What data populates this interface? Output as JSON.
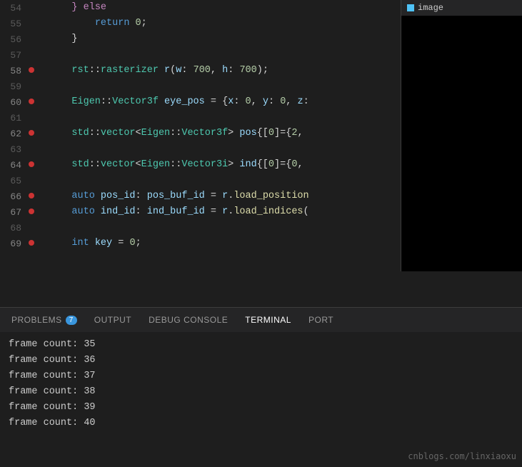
{
  "editor": {
    "lines": [
      {
        "num": "54",
        "content_html": "&nbsp;&nbsp;&nbsp;&nbsp;<span class='kw2'>}</span> <span class='kw2'>else</span>",
        "breakpoint": false,
        "fold": false
      },
      {
        "num": "55",
        "content_html": "&nbsp;&nbsp;&nbsp;&nbsp;&nbsp;&nbsp;&nbsp;&nbsp;<span class='kw'>return</span> <span class='num'>0</span><span class='punc'>;</span>",
        "breakpoint": false,
        "fold": false
      },
      {
        "num": "56",
        "content_html": "&nbsp;&nbsp;&nbsp;&nbsp;<span class='punc'>}</span>",
        "breakpoint": false,
        "fold": false
      },
      {
        "num": "57",
        "content_html": "",
        "breakpoint": false,
        "fold": false
      },
      {
        "num": "58",
        "content_html": "&nbsp;&nbsp;&nbsp;&nbsp;<span class='type'>rst</span><span class='punc'>::</span><span class='type'>rasterizer</span> <span class='var'>r</span><span class='punc'>(</span><span class='param'>w</span><span class='punc'>:</span> <span class='num'>700</span><span class='punc'>,</span> <span class='param'>h</span><span class='punc'>:</span> <span class='num'>700</span><span class='punc'>);</span>",
        "breakpoint": true,
        "fold": false
      },
      {
        "num": "59",
        "content_html": "",
        "breakpoint": false,
        "fold": false
      },
      {
        "num": "60",
        "content_html": "&nbsp;&nbsp;&nbsp;&nbsp;<span class='type'>Eigen</span><span class='punc'>::</span><span class='type'>Vector3f</span> <span class='var'>eye_pos</span> <span class='op'>=</span> <span class='punc'>{</span><span class='param'>x</span><span class='punc'>:</span> <span class='num'>0</span><span class='punc'>,</span> <span class='param'>y</span><span class='punc'>:</span> <span class='num'>0</span><span class='punc'>,</span> <span class='param'>z</span><span class='punc'>:</span>",
        "breakpoint": true,
        "fold": false
      },
      {
        "num": "61",
        "content_html": "",
        "breakpoint": false,
        "fold": false
      },
      {
        "num": "62",
        "content_html": "&nbsp;&nbsp;&nbsp;&nbsp;<span class='type'>std</span><span class='punc'>::</span><span class='type'>vector</span><span class='punc'>&lt;</span><span class='type'>Eigen</span><span class='punc'>::</span><span class='type'>Vector3f</span><span class='punc'>&gt;</span> <span class='var'>pos</span><span class='punc'>{[</span><span class='num'>0</span><span class='punc'>]={</span><span class='num'>2</span><span class='punc'>,</span>",
        "breakpoint": true,
        "fold": false
      },
      {
        "num": "63",
        "content_html": "",
        "breakpoint": false,
        "fold": false
      },
      {
        "num": "64",
        "content_html": "&nbsp;&nbsp;&nbsp;&nbsp;<span class='type'>std</span><span class='punc'>::</span><span class='type'>vector</span><span class='punc'>&lt;</span><span class='type'>Eigen</span><span class='punc'>::</span><span class='type'>Vector3i</span><span class='punc'>&gt;</span> <span class='var'>ind</span><span class='punc'>{[</span><span class='num'>0</span><span class='punc'>]={</span><span class='num'>0</span><span class='punc'>,</span>",
        "breakpoint": true,
        "fold": false
      },
      {
        "num": "65",
        "content_html": "",
        "breakpoint": false,
        "fold": false
      },
      {
        "num": "66",
        "content_html": "&nbsp;&nbsp;&nbsp;&nbsp;<span class='kw'>auto</span> <span class='var'>pos_id</span><span class='punc'>:</span> <span class='var'>pos_buf_id</span> <span class='op'>=</span> <span class='var'>r</span><span class='punc'>.</span><span class='fn'>load_position</span>",
        "breakpoint": true,
        "fold": false
      },
      {
        "num": "67",
        "content_html": "&nbsp;&nbsp;&nbsp;&nbsp;<span class='kw'>auto</span> <span class='var'>ind_id</span><span class='punc'>:</span> <span class='var'>ind_buf_id</span> <span class='op'>=</span> <span class='var'>r</span><span class='punc'>.</span><span class='fn'>load_indices</span><span class='punc'>(</span>",
        "breakpoint": true,
        "fold": false
      },
      {
        "num": "68",
        "content_html": "",
        "breakpoint": false,
        "fold": false
      },
      {
        "num": "69",
        "content_html": "&nbsp;&nbsp;&nbsp;&nbsp;<span class='kw'>int</span> <span class='var'>key</span> <span class='op'>=</span> <span class='num'>0</span><span class='punc'>;</span>",
        "breakpoint": true,
        "fold": false
      }
    ],
    "image_panel": {
      "title": "image"
    }
  },
  "panel_tabs": {
    "items": [
      {
        "id": "problems",
        "label": "PROBLEMS",
        "active": false,
        "badge": "7"
      },
      {
        "id": "output",
        "label": "OUTPUT",
        "active": false,
        "badge": null
      },
      {
        "id": "debug-console",
        "label": "DEBUG CONSOLE",
        "active": false,
        "badge": null
      },
      {
        "id": "terminal",
        "label": "TERMINAL",
        "active": true,
        "badge": null
      },
      {
        "id": "ports",
        "label": "PORT",
        "active": false,
        "badge": null
      }
    ]
  },
  "terminal": {
    "lines": [
      {
        "text": "frame count: 35"
      },
      {
        "text": "frame count: 36"
      },
      {
        "text": "frame count: 37"
      },
      {
        "text": "frame count: 38"
      },
      {
        "text": "frame count: 39"
      },
      {
        "text": "frame count: 40"
      }
    ],
    "watermark": "cnblogs.com/linxiaoxu"
  }
}
